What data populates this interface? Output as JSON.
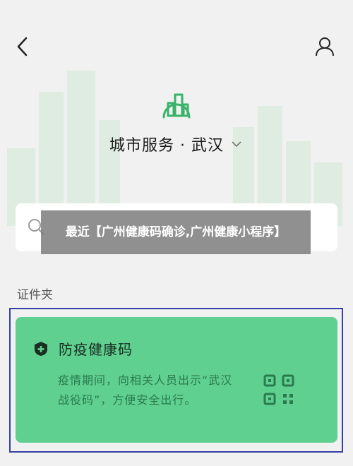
{
  "header": {
    "back_icon": "back-chevron-icon",
    "user_icon": "user-icon"
  },
  "city": {
    "logo_icon": "city-buildings-icon",
    "title": "城市服务 · 武汉",
    "dropdown_icon": "chevron-down-icon"
  },
  "search": {
    "icon": "search-icon"
  },
  "overlay": {
    "text": "最近【广州健康码确诊,广州健康小程序】"
  },
  "wallet": {
    "section_label": "证件夹",
    "card": {
      "title": "防疫健康码",
      "description": "疫情期间，向相关人员出示“武汉战役码”，方便安全出行。",
      "plus_icon": "plus-badge-icon",
      "qr_icon": "qr-code-icon"
    }
  },
  "colors": {
    "card_green": "#5fd08f",
    "accent_green": "#39b26a",
    "frame_blue": "#3541a3",
    "background": "#f0f1f0"
  }
}
